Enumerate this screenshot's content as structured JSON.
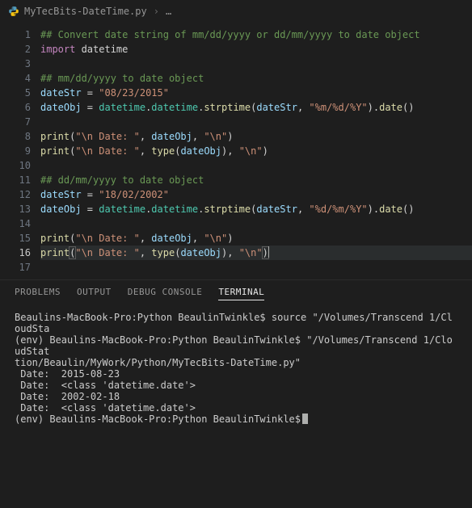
{
  "breadcrumb": {
    "file_icon": "python-icon",
    "file_name": "MyTecBits-DateTime.py",
    "ellipsis": "…"
  },
  "editor": {
    "lines": [
      {
        "n": 1,
        "tokens": [
          [
            "## Convert date string of mm/dd/yyyy or dd/mm/yyyy to date object",
            "tk-comment"
          ]
        ]
      },
      {
        "n": 2,
        "tokens": [
          [
            "import",
            "tk-keyword"
          ],
          [
            " datetime",
            "tk-default"
          ]
        ]
      },
      {
        "n": 3,
        "tokens": [
          [
            "",
            "tk-default"
          ]
        ]
      },
      {
        "n": 4,
        "tokens": [
          [
            "## mm/dd/yyyy to date object",
            "tk-comment"
          ]
        ]
      },
      {
        "n": 5,
        "tokens": [
          [
            "dateStr",
            "tk-var"
          ],
          [
            " = ",
            "tk-default"
          ],
          [
            "\"08/23/2015\"",
            "tk-str"
          ]
        ]
      },
      {
        "n": 6,
        "tokens": [
          [
            "dateObj",
            "tk-var"
          ],
          [
            " = ",
            "tk-default"
          ],
          [
            "datetime",
            "tk-type"
          ],
          [
            ".",
            "tk-default"
          ],
          [
            "datetime",
            "tk-type"
          ],
          [
            ".",
            "tk-default"
          ],
          [
            "strptime",
            "tk-func"
          ],
          [
            "(",
            "tk-default"
          ],
          [
            "dateStr",
            "tk-var"
          ],
          [
            ", ",
            "tk-default"
          ],
          [
            "\"%m/%d/%Y\"",
            "tk-str"
          ],
          [
            ").",
            "tk-default"
          ],
          [
            "date",
            "tk-func"
          ],
          [
            "()",
            "tk-default"
          ]
        ]
      },
      {
        "n": 7,
        "tokens": [
          [
            "",
            "tk-default"
          ]
        ]
      },
      {
        "n": 8,
        "tokens": [
          [
            "print",
            "tk-func"
          ],
          [
            "(",
            "tk-default"
          ],
          [
            "\"\\n Date: \"",
            "tk-str"
          ],
          [
            ", ",
            "tk-default"
          ],
          [
            "dateObj",
            "tk-var"
          ],
          [
            ", ",
            "tk-default"
          ],
          [
            "\"\\n\"",
            "tk-str"
          ],
          [
            ")",
            "tk-default"
          ]
        ]
      },
      {
        "n": 9,
        "tokens": [
          [
            "print",
            "tk-func"
          ],
          [
            "(",
            "tk-default"
          ],
          [
            "\"\\n Date: \"",
            "tk-str"
          ],
          [
            ", ",
            "tk-default"
          ],
          [
            "type",
            "tk-func"
          ],
          [
            "(",
            "tk-default"
          ],
          [
            "dateObj",
            "tk-var"
          ],
          [
            "), ",
            "tk-default"
          ],
          [
            "\"\\n\"",
            "tk-str"
          ],
          [
            ")",
            "tk-default"
          ]
        ]
      },
      {
        "n": 10,
        "tokens": [
          [
            "",
            "tk-default"
          ]
        ]
      },
      {
        "n": 11,
        "tokens": [
          [
            "## dd/mm/yyyy to date object",
            "tk-comment"
          ]
        ]
      },
      {
        "n": 12,
        "tokens": [
          [
            "dateStr",
            "tk-var"
          ],
          [
            " = ",
            "tk-default"
          ],
          [
            "\"18/02/2002\"",
            "tk-str"
          ]
        ]
      },
      {
        "n": 13,
        "tokens": [
          [
            "dateObj",
            "tk-var"
          ],
          [
            " = ",
            "tk-default"
          ],
          [
            "datetime",
            "tk-type"
          ],
          [
            ".",
            "tk-default"
          ],
          [
            "datetime",
            "tk-type"
          ],
          [
            ".",
            "tk-default"
          ],
          [
            "strptime",
            "tk-func"
          ],
          [
            "(",
            "tk-default"
          ],
          [
            "dateStr",
            "tk-var"
          ],
          [
            ", ",
            "tk-default"
          ],
          [
            "\"%d/%m/%Y\"",
            "tk-str"
          ],
          [
            ").",
            "tk-default"
          ],
          [
            "date",
            "tk-func"
          ],
          [
            "()",
            "tk-default"
          ]
        ]
      },
      {
        "n": 14,
        "tokens": [
          [
            "",
            "tk-default"
          ]
        ]
      },
      {
        "n": 15,
        "tokens": [
          [
            "print",
            "tk-func"
          ],
          [
            "(",
            "tk-default"
          ],
          [
            "\"\\n Date: \"",
            "tk-str"
          ],
          [
            ", ",
            "tk-default"
          ],
          [
            "dateObj",
            "tk-var"
          ],
          [
            ", ",
            "tk-default"
          ],
          [
            "\"\\n\"",
            "tk-str"
          ],
          [
            ")",
            "tk-default"
          ]
        ]
      },
      {
        "n": 16,
        "active": true,
        "tokens": [
          [
            "print",
            "tk-func"
          ],
          [
            "(",
            "tk-default tk-paren-hl"
          ],
          [
            "\"\\n Date: \"",
            "tk-str"
          ],
          [
            ", ",
            "tk-default"
          ],
          [
            "type",
            "tk-func"
          ],
          [
            "(",
            "tk-default"
          ],
          [
            "dateObj",
            "tk-var"
          ],
          [
            "), ",
            "tk-default"
          ],
          [
            "\"\\n\"",
            "tk-str"
          ],
          [
            ")",
            "tk-default tk-paren-hl"
          ]
        ],
        "cursor": true
      },
      {
        "n": 17,
        "tokens": [
          [
            "",
            "tk-default"
          ]
        ]
      }
    ]
  },
  "panel": {
    "tabs": [
      {
        "label": "PROBLEMS",
        "active": false
      },
      {
        "label": "OUTPUT",
        "active": false
      },
      {
        "label": "DEBUG CONSOLE",
        "active": false
      },
      {
        "label": "TERMINAL",
        "active": true
      }
    ]
  },
  "terminal": {
    "lines": [
      "Beaulins-MacBook-Pro:Python BeaulinTwinkle$ source \"/Volumes/Transcend 1/CloudSta",
      "(env) Beaulins-MacBook-Pro:Python BeaulinTwinkle$ \"/Volumes/Transcend 1/CloudStat",
      "tion/Beaulin/MyWork/Python/MyTecBits-DateTime.py\"",
      "",
      " Date:  2015-08-23",
      "",
      " Date:  <class 'datetime.date'>",
      "",
      " Date:  2002-02-18",
      "",
      " Date:  <class 'datetime.date'>",
      "",
      "(env) Beaulins-MacBook-Pro:Python BeaulinTwinkle$"
    ]
  }
}
